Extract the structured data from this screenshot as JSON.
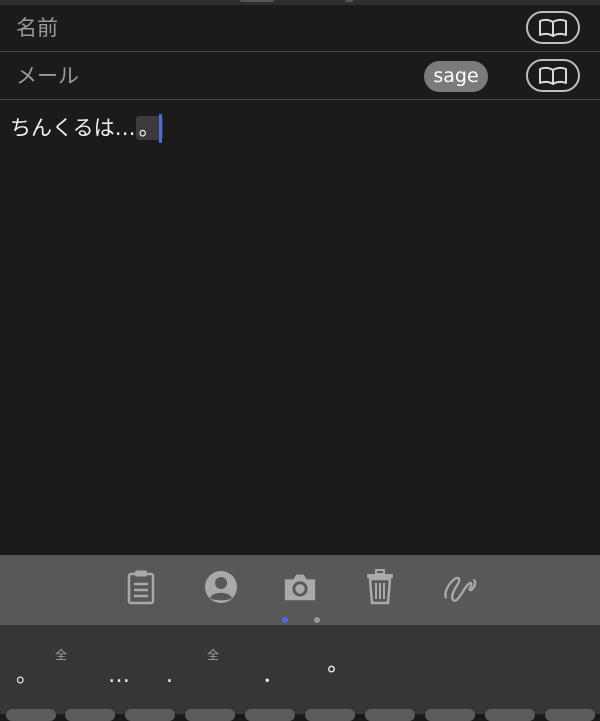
{
  "form": {
    "name_placeholder": "名前",
    "mail_placeholder": "メール",
    "sage_label": "sage"
  },
  "editor": {
    "text": "ちんくるは…",
    "marked_text": "。"
  },
  "toolbar": {
    "icons": [
      "clipboard-icon",
      "person-icon",
      "camera-icon",
      "trash-icon",
      "scribble-icon"
    ],
    "pages": 2,
    "active_page": 1
  },
  "candidates": {
    "items": [
      "。",
      "…",
      ".",
      "．",
      "°"
    ],
    "fullwidth_marker": "全"
  },
  "colors": {
    "accent": "#4f6ae0",
    "background": "#1b1b1b",
    "toolbar": "#585858",
    "candidate_bar": "#363636"
  }
}
